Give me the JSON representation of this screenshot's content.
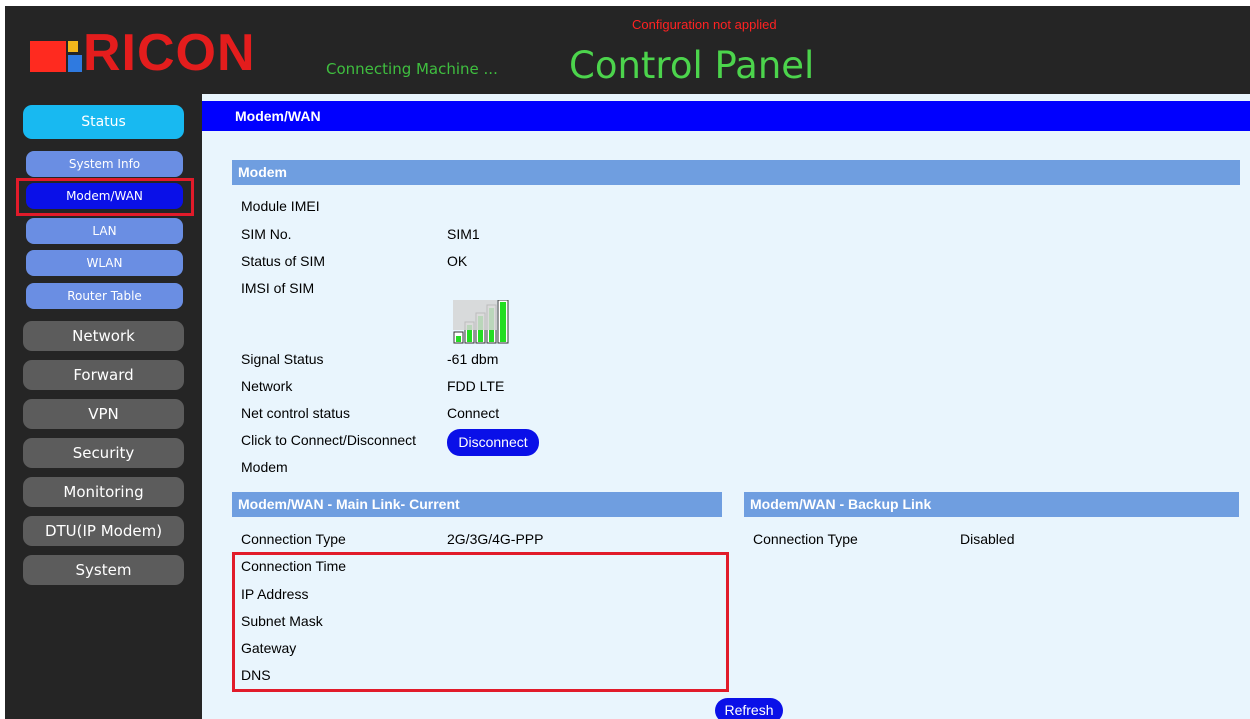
{
  "header": {
    "config_warning": "Configuration not applied",
    "logo_text": "RICON",
    "tagline": "Connecting Machine ...",
    "title": "Control Panel"
  },
  "sidebar": {
    "status_label": "Status",
    "sub_items": [
      {
        "label": "System Info"
      },
      {
        "label": "Modem/WAN",
        "active": true
      },
      {
        "label": "LAN"
      },
      {
        "label": "WLAN"
      },
      {
        "label": "Router Table"
      }
    ],
    "main_items": [
      {
        "label": "Network"
      },
      {
        "label": "Forward"
      },
      {
        "label": "VPN"
      },
      {
        "label": "Security"
      },
      {
        "label": "Monitoring"
      },
      {
        "label": "DTU(IP Modem)"
      },
      {
        "label": "System"
      }
    ]
  },
  "content": {
    "page_title": "Modem/WAN",
    "modem": {
      "heading": "Modem",
      "rows": [
        {
          "label": "Module IMEI",
          "value": ""
        },
        {
          "label": "SIM No.",
          "value": "SIM1"
        },
        {
          "label": "Status of SIM",
          "value": "OK"
        },
        {
          "label": "IMSI of SIM",
          "value": ""
        },
        {
          "label": "Signal Status",
          "value": "-61 dbm"
        },
        {
          "label": "Network",
          "value": "FDD LTE"
        },
        {
          "label": "Net control status",
          "value": "Connect"
        }
      ],
      "connect_label_line1": "Click to Connect/Disconnect",
      "connect_label_line2": "Modem",
      "disconnect_button": "Disconnect",
      "signal_bars_filled": 4,
      "signal_bars_total": 5
    },
    "main_link": {
      "heading": "Modem/WAN - Main Link- Current",
      "rows": [
        {
          "label": "Connection Type",
          "value": "2G/3G/4G-PPP"
        },
        {
          "label": "Connection Time",
          "value": ""
        },
        {
          "label": "IP Address",
          "value": ""
        },
        {
          "label": "Subnet Mask",
          "value": ""
        },
        {
          "label": "Gateway",
          "value": ""
        },
        {
          "label": "DNS",
          "value": ""
        }
      ]
    },
    "backup_link": {
      "heading": "Modem/WAN - Backup Link",
      "rows": [
        {
          "label": "Connection Type",
          "value": "Disabled"
        }
      ]
    },
    "refresh_button": "Refresh"
  },
  "colors": {
    "sidebar_bg": "#252525",
    "status_button": "#18b9f1",
    "sub_item": "#6a8ee3",
    "active_item": "#0a10e8",
    "main_item": "#5c5c5c",
    "section_header": "#6f9ee0",
    "page_title_bar": "#0000ff",
    "content_bg": "#e9f5fd",
    "highlight_box": "#e11b2a",
    "signal_green": "#22dd22"
  }
}
